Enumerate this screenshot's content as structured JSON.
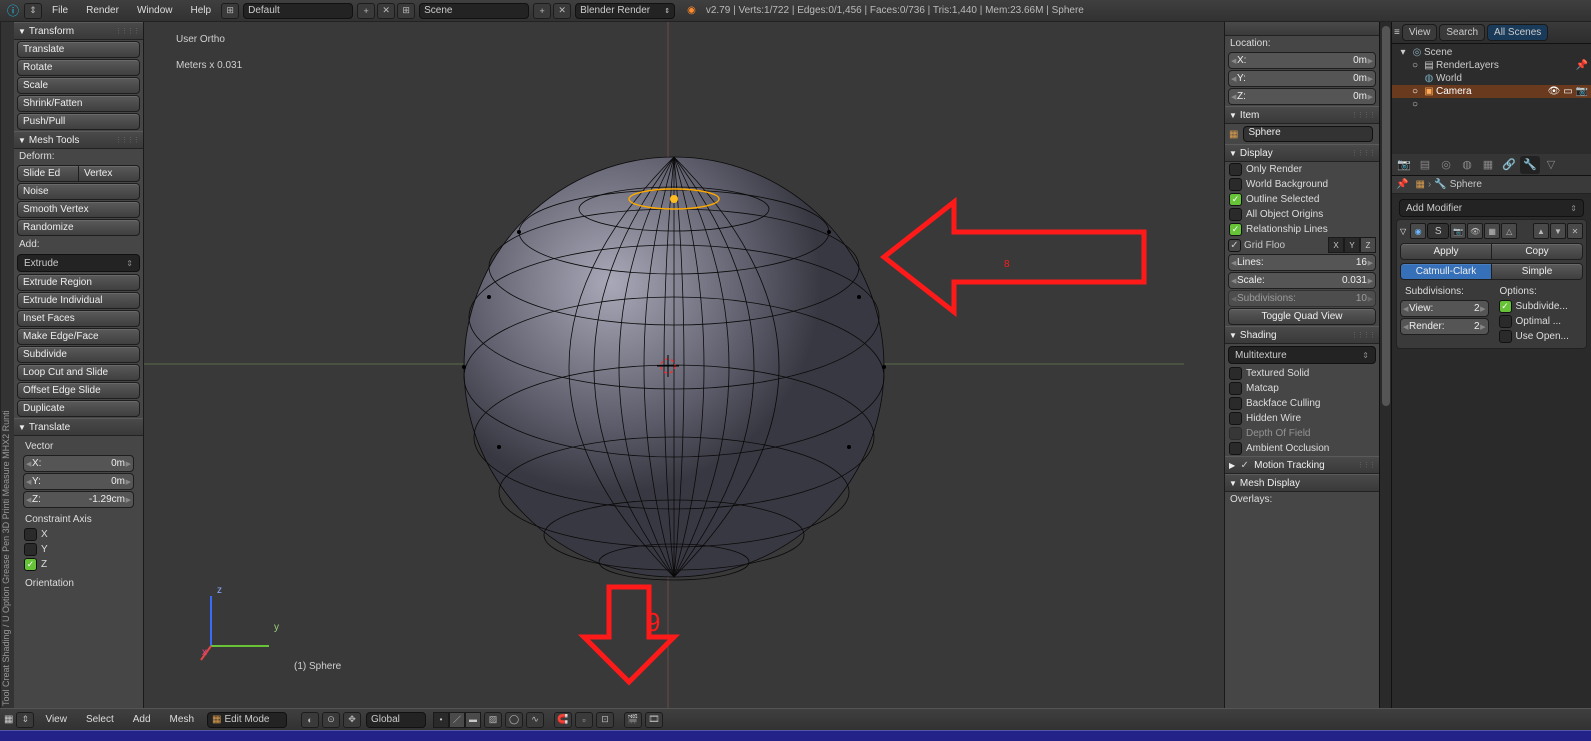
{
  "topmenu": {
    "file": "File",
    "render": "Render",
    "window": "Window",
    "help": "Help"
  },
  "layout_sel": "Default",
  "scene_sel": "Scene",
  "engine_sel": "Blender Render",
  "stats": "v2.79 | Verts:1/722 | Edges:0/1,456 | Faces:0/736 | Tris:1,440 | Mem:23.66M | Sphere",
  "tooltabs": "Tool  Creat  Shading / U  Option  Grease Pen  3D Printi  Measure  MHX2 Runti",
  "transform": {
    "hdr": "Transform",
    "translate": "Translate",
    "rotate": "Rotate",
    "scale": "Scale",
    "shrink": "Shrink/Fatten",
    "push": "Push/Pull"
  },
  "meshtools": {
    "hdr": "Mesh Tools",
    "deform": "Deform:",
    "slide": "Slide Ed",
    "vertex": "Vertex",
    "noise": "Noise",
    "smooth": "Smooth Vertex",
    "random": "Randomize",
    "addlbl": "Add:",
    "extrude_sel": "Extrude",
    "extr_reg": "Extrude Region",
    "extr_ind": "Extrude Individual",
    "inset": "Inset Faces",
    "mef": "Make Edge/Face",
    "subd": "Subdivide",
    "loop": "Loop Cut and Slide",
    "offset": "Offset Edge Slide",
    "dup": "Duplicate"
  },
  "op": {
    "hdr": "Translate",
    "vector": "Vector",
    "x_l": "X:",
    "x_v": "0m",
    "y_l": "Y:",
    "y_v": "0m",
    "z_l": "Z:",
    "z_v": "-1.29cm",
    "caxis": "Constraint Axis",
    "cx": "X",
    "cy": "Y",
    "cz": "Z",
    "orient": "Orientation"
  },
  "viewport": {
    "ortho": "User Ortho",
    "scale": "Meters x 0.031",
    "obj": "(1) Sphere"
  },
  "npanel": {
    "loc": "Location:",
    "lx": "X:",
    "ly": "Y:",
    "lz": "Z:",
    "lxv": "0m",
    "lyv": "0m",
    "lzv": "0m",
    "item": "Item",
    "name": "Sphere",
    "display": "Display",
    "only": "Only Render",
    "world": "World Background",
    "outline": "Outline Selected",
    "origins": "All Object Origins",
    "rel": "Relationship Lines",
    "grid": "Grid Floo",
    "xb": "X",
    "yb": "Y",
    "zb": "Z",
    "lines_l": "Lines:",
    "lines_v": "16",
    "scale_l": "Scale:",
    "scale_v": "0.031",
    "subd_l": "Subdivisions:",
    "subd_v": "10",
    "quad": "Toggle Quad View",
    "shading": "Shading",
    "multi": "Multitexture",
    "tsolid": "Textured Solid",
    "matcap": "Matcap",
    "bface": "Backface Culling",
    "hwire": "Hidden Wire",
    "dof": "Depth Of Field",
    "ao": "Ambient Occlusion",
    "motion": "Motion Tracking",
    "meshd": "Mesh Display",
    "overlays": "Overlays:"
  },
  "outliner": {
    "view": "View",
    "search": "Search",
    "all": "All Scenes",
    "scene": "Scene",
    "rlayers": "RenderLayers",
    "world": "World",
    "camera": "Camera"
  },
  "props": {
    "path": "Sphere",
    "addmod": "Add Modifier",
    "modname": "S",
    "apply": "Apply",
    "copy": "Copy",
    "catmull": "Catmull-Clark",
    "simple": "Simple",
    "subdiv": "Subdivisions:",
    "options": "Options:",
    "view_l": "View:",
    "view_v": "2",
    "render_l": "Render:",
    "render_v": "2",
    "subuv": "Subdivide...",
    "opt": "Optimal ...",
    "open": "Use Open..."
  },
  "header3d": {
    "view": "View",
    "select": "Select",
    "add": "Add",
    "mesh": "Mesh",
    "mode": "Edit Mode",
    "orient": "Global"
  },
  "annot": {
    "a": "8",
    "b": "9"
  }
}
